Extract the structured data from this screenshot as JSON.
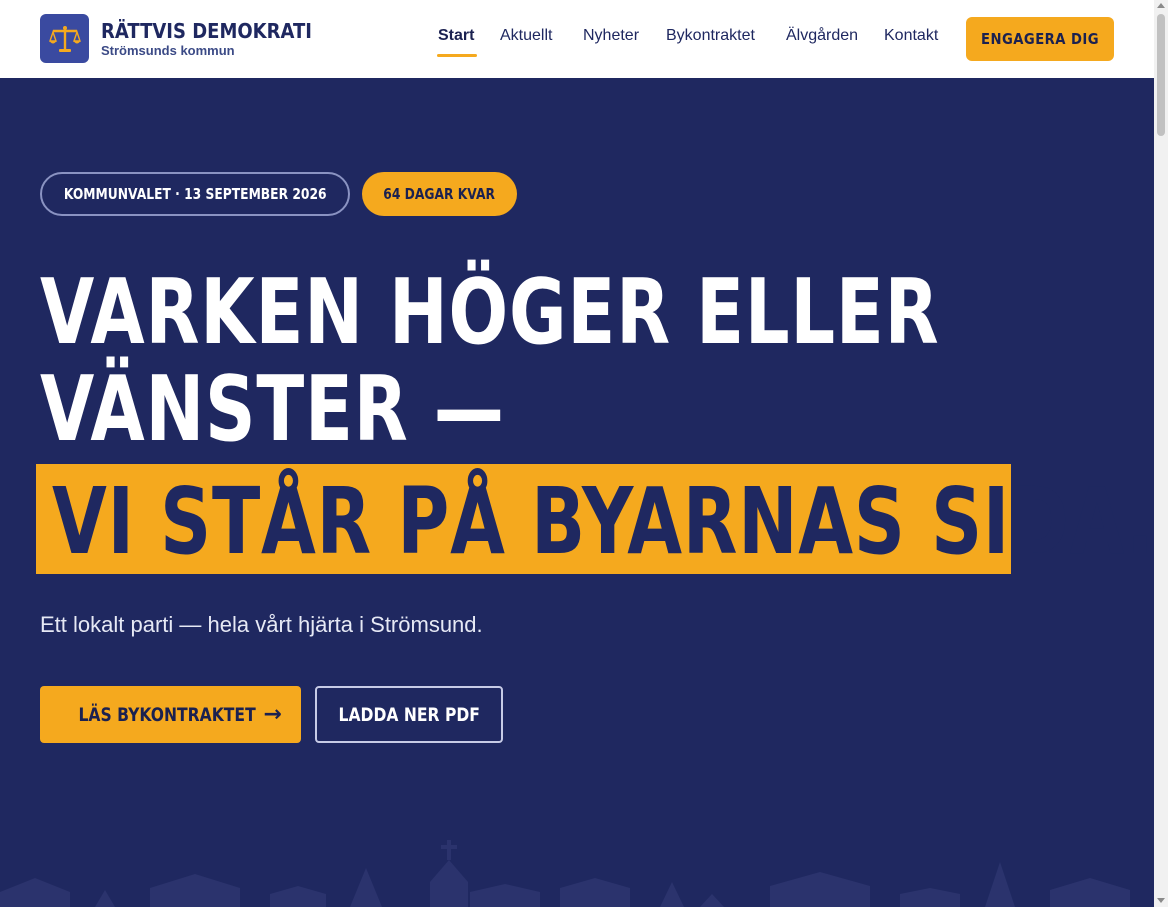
{
  "brand": {
    "title": "RÄTTVIS DEMOKRATI",
    "subtitle": "Strömsunds kommun",
    "logo_icon": "scales-icon"
  },
  "nav": {
    "items": [
      {
        "label": "Start",
        "active": true
      },
      {
        "label": "Aktuellt",
        "active": false
      },
      {
        "label": "Nyheter",
        "active": false
      },
      {
        "label": "Bykontraktet",
        "active": false
      },
      {
        "label": "Älvgården",
        "active": false
      },
      {
        "label": "Kontakt",
        "active": false
      }
    ],
    "cta": "ENGAGERA DIG"
  },
  "hero": {
    "election_badge": "KOMMUNVALET · 13 SEPTEMBER 2026",
    "countdown_badge": "64 DAGAR KVAR",
    "headline_line1": "VARKEN HÖGER ELLER",
    "headline_line2": "VÄNSTER —",
    "headline_highlight": "VI STÅR PÅ BYARNAS SIDA.",
    "lead": "Ett lokalt parti — hela vårt hjärta i Strömsund.",
    "primary_button": "LÄS BYKONTRAKTET",
    "primary_arrow": "→",
    "secondary_button": "LADDA NER PDF"
  },
  "colors": {
    "navy": "#1f2860",
    "gold": "#f5a91e",
    "white": "#ffffff"
  }
}
